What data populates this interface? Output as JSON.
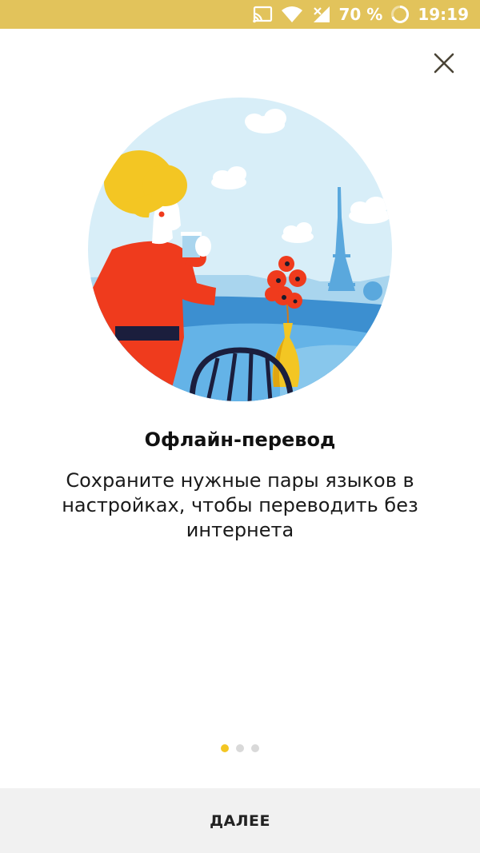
{
  "status_bar": {
    "battery_percent": "70 %",
    "time": "19:19",
    "icons": [
      "cast-icon",
      "wifi-icon",
      "signal-no-data-icon",
      "battery-circle-icon"
    ],
    "background_color": "#e2c35b"
  },
  "onboarding": {
    "close_icon": "close-icon",
    "illustration": "woman-cafe-eiffel-tower-illustration",
    "title": "Офлайн-перевод",
    "description": "Сохраните нужные пары языков в настройках, чтобы переводить без интернета",
    "pager": {
      "total": 3,
      "active_index": 0,
      "active_color": "#f3c623",
      "inactive_color": "#d9d9d9"
    },
    "next_button_label": "ДАЛЕЕ"
  }
}
